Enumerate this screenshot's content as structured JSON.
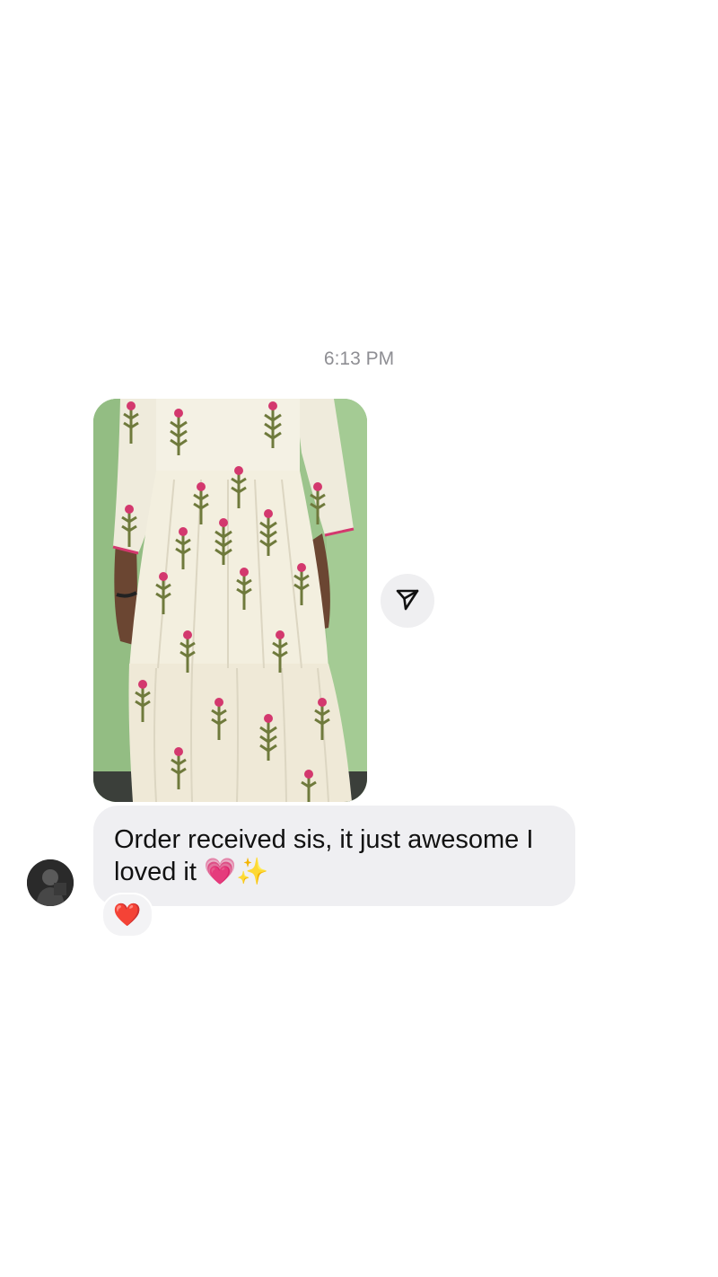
{
  "chat": {
    "timestamp": "6:13 PM",
    "image_message": {
      "description_icon": "photo-of-printed-cotton-dress"
    },
    "share_icon": "share-send-icon",
    "text_message": {
      "text": "Order received sis, it just awesome I loved it 💗✨"
    },
    "reaction": {
      "emoji": "❤️"
    },
    "sender": {
      "avatar_icon": "avatar"
    }
  },
  "colors": {
    "bubble_bg": "#efeff2",
    "timestamp": "#8e8e93",
    "wall_green": "#9dc68e",
    "dress_white": "#f3efdf",
    "flower_pink": "#d3386e",
    "leaf_olive": "#6f7a3c"
  }
}
